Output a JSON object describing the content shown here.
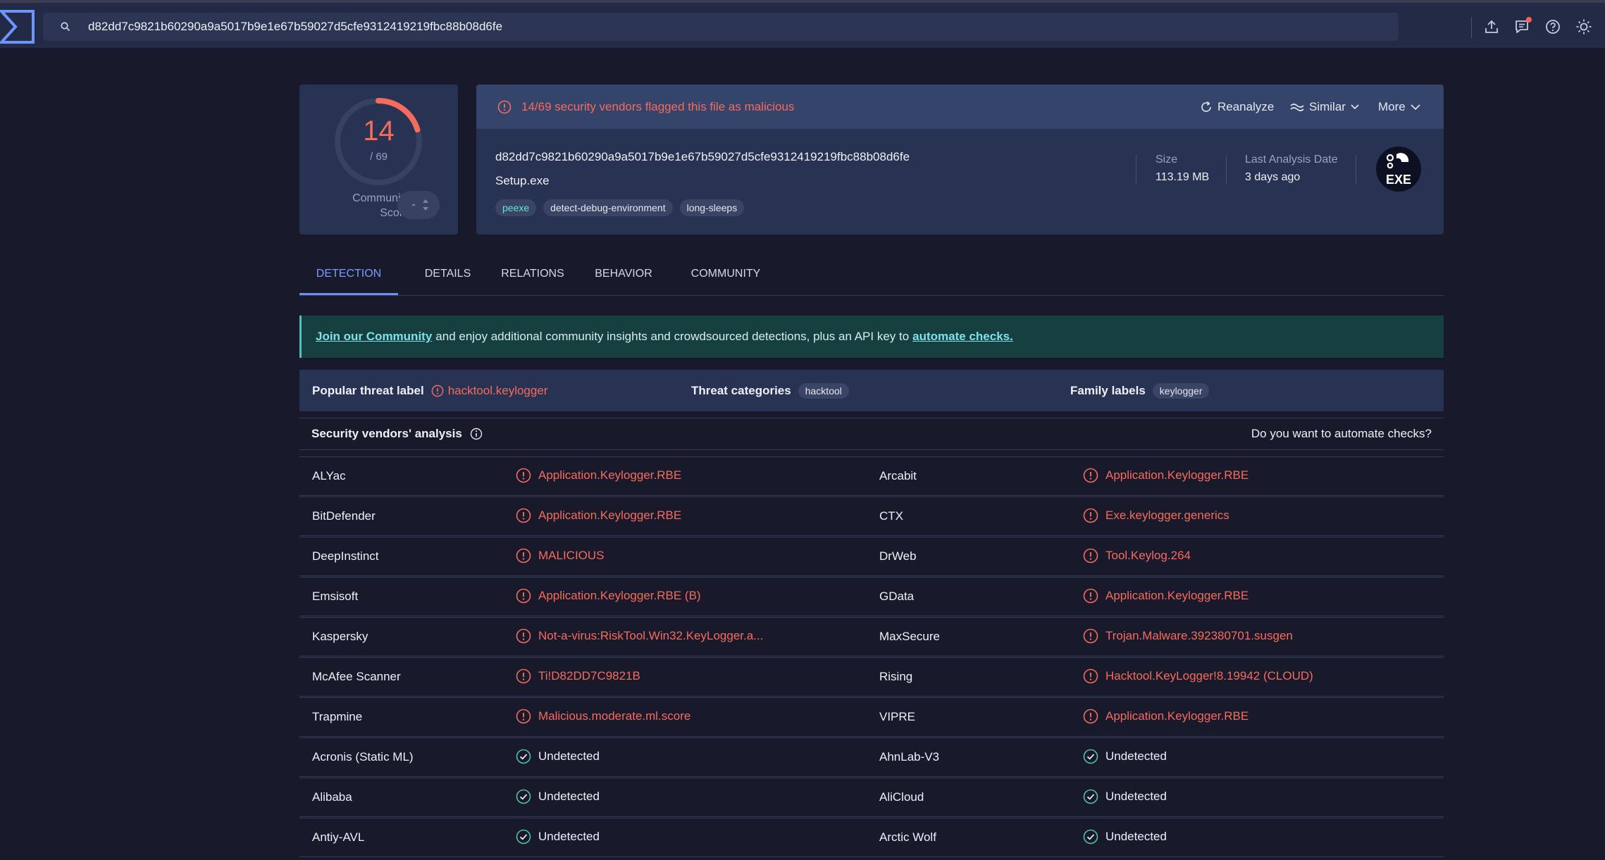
{
  "search": {
    "value": "d82dd7c9821b60290a9a5017b9e1e67b59027d5cfe9312419219fbc88b08d6fe"
  },
  "score": {
    "detected": "14",
    "total": "/ 69",
    "community_label_line1": "Community",
    "community_label_line2": "Score"
  },
  "file": {
    "flag_text": "14/69 security vendors flagged this file as malicious",
    "actions": {
      "reanalyze": "Reanalyze",
      "similar": "Similar",
      "more": "More"
    },
    "hash": "d82dd7c9821b60290a9a5017b9e1e67b59027d5cfe9312419219fbc88b08d6fe",
    "name": "Setup.exe",
    "tags": [
      "peexe",
      "detect-debug-environment",
      "long-sleeps"
    ],
    "size_label": "Size",
    "size_value": "113.19 MB",
    "last_analysis_label": "Last Analysis Date",
    "last_analysis_value": "3 days ago",
    "type_badge": "EXE"
  },
  "tabs": [
    "DETECTION",
    "DETAILS",
    "RELATIONS",
    "BEHAVIOR",
    "COMMUNITY"
  ],
  "banner": {
    "link1": "Join our Community",
    "middle": "and enjoy additional community insights and crowdsourced detections, plus an API key to",
    "link2": "automate checks."
  },
  "threat": {
    "popular_label": "Popular threat label",
    "popular_value": "hacktool.keylogger",
    "categories_label": "Threat categories",
    "categories_value": "hacktool",
    "family_label": "Family labels",
    "family_value": "keylogger"
  },
  "vendors_header": {
    "title": "Security vendors' analysis",
    "automate": "Do you want to automate checks?"
  },
  "vendors": [
    [
      {
        "name": "ALYac",
        "result": "Application.Keylogger.RBE",
        "status": "malicious"
      },
      {
        "name": "Arcabit",
        "result": "Application.Keylogger.RBE",
        "status": "malicious"
      }
    ],
    [
      {
        "name": "BitDefender",
        "result": "Application.Keylogger.RBE",
        "status": "malicious"
      },
      {
        "name": "CTX",
        "result": "Exe.keylogger.generics",
        "status": "malicious"
      }
    ],
    [
      {
        "name": "DeepInstinct",
        "result": "MALICIOUS",
        "status": "malicious"
      },
      {
        "name": "DrWeb",
        "result": "Tool.Keylog.264",
        "status": "malicious"
      }
    ],
    [
      {
        "name": "Emsisoft",
        "result": "Application.Keylogger.RBE (B)",
        "status": "malicious"
      },
      {
        "name": "GData",
        "result": "Application.Keylogger.RBE",
        "status": "malicious"
      }
    ],
    [
      {
        "name": "Kaspersky",
        "result": "Not-a-virus:RiskTool.Win32.KeyLogger.a...",
        "status": "malicious"
      },
      {
        "name": "MaxSecure",
        "result": "Trojan.Malware.392380701.susgen",
        "status": "malicious"
      }
    ],
    [
      {
        "name": "McAfee Scanner",
        "result": "Ti!D82DD7C9821B",
        "status": "malicious"
      },
      {
        "name": "Rising",
        "result": "Hacktool.KeyLogger!8.19942 (CLOUD)",
        "status": "malicious"
      }
    ],
    [
      {
        "name": "Trapmine",
        "result": "Malicious.moderate.ml.score",
        "status": "malicious"
      },
      {
        "name": "VIPRE",
        "result": "Application.Keylogger.RBE",
        "status": "malicious"
      }
    ],
    [
      {
        "name": "Acronis (Static ML)",
        "result": "Undetected",
        "status": "undetected"
      },
      {
        "name": "AhnLab-V3",
        "result": "Undetected",
        "status": "undetected"
      }
    ],
    [
      {
        "name": "Alibaba",
        "result": "Undetected",
        "status": "undetected"
      },
      {
        "name": "AliCloud",
        "result": "Undetected",
        "status": "undetected"
      }
    ],
    [
      {
        "name": "Antiy-AVL",
        "result": "Undetected",
        "status": "undetected"
      },
      {
        "name": "Arctic Wolf",
        "result": "Undetected",
        "status": "undetected"
      }
    ]
  ],
  "colors": {
    "malicious": "#f56b5c",
    "accent": "#6f8ef5",
    "undetected": "#4fc3a0"
  },
  "score_fraction": 0.2029
}
